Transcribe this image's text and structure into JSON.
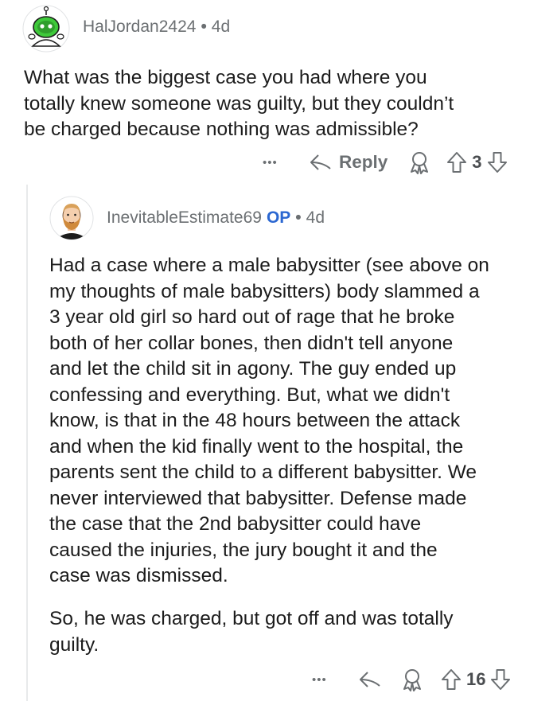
{
  "parent_comment": {
    "username": "HalJordan2424",
    "separator": "•",
    "age": "4d",
    "text_lines": [
      "What was the biggest case you had where you",
      "totally knew someone was guilty, but they couldn’t",
      "be charged because nothing was admissible?"
    ],
    "actions": {
      "more": "•••",
      "reply_label": "Reply",
      "vote_count": "3"
    }
  },
  "reply_comment": {
    "username": "InevitableEstimate69",
    "op_badge": "OP",
    "separator": "•",
    "age": "4d",
    "paragraph1_lines": [
      "Had a case where a male babysitter (see above on",
      "my thoughts of male babysitters) body slammed a",
      "3 year old girl so hard out of rage that he broke",
      "both of her collar bones, then didn't tell anyone",
      "and let the child sit in agony. The guy ended up",
      "confessing and everything. But, what we didn't",
      "know, is that in the 48 hours between the attack",
      "and when the kid finally went to the hospital, the",
      "parents sent the child to a different babysitter. We",
      "never interviewed that babysitter. Defense made",
      "the case that the 2nd babysitter could have",
      "caused the injuries, the jury bought it and the",
      "case was dismissed."
    ],
    "paragraph2_lines": [
      "So, he was charged, but got off and was totally",
      "guilty."
    ],
    "actions": {
      "more": "•••",
      "vote_count": "16"
    }
  },
  "colors": {
    "meta_gray": "#6b6f72",
    "op_blue": "#2b67d1",
    "text": "#1c1c1c",
    "snoo_green": "#3ec93a"
  }
}
